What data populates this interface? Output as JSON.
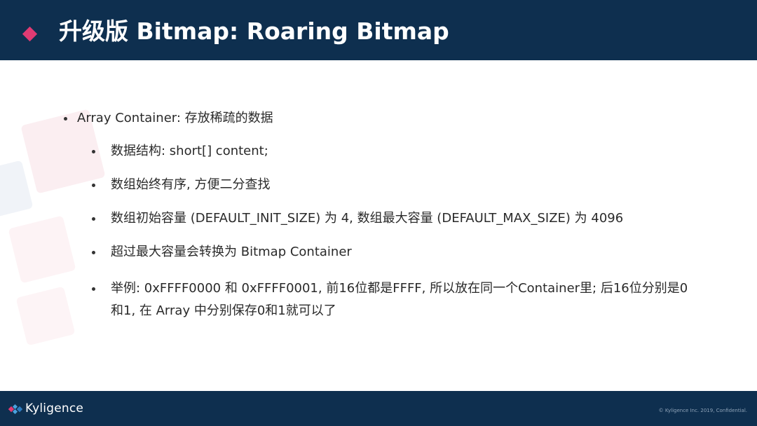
{
  "slide": {
    "title": "升级版 Bitmap: Roaring Bitmap"
  },
  "bullets": {
    "main": "Array Container:  存放稀疏的数据",
    "sub": [
      "数据结构: short[] content;",
      "数组始终有序, 方便二分查找",
      "数组初始容量 (DEFAULT_INIT_SIZE) 为 4, 数组最大容量 (DEFAULT_MAX_SIZE) 为 4096",
      "超过最大容量会转换为 Bitmap Container",
      "举例: 0xFFFF0000 和 0xFFFF0001, 前16位都是FFFF, 所以放在同一个Container里; 后16位分别是0和1, 在 Array 中分别保存0和1就可以了"
    ]
  },
  "footer": {
    "logo_text": "Kyligence",
    "copyright": "© Kyligence Inc. 2019, Confidential."
  },
  "colors": {
    "header_bg": "#0e2f4f",
    "accent_diamond": "#e03b73",
    "footer_bg": "#0e2f4f"
  }
}
